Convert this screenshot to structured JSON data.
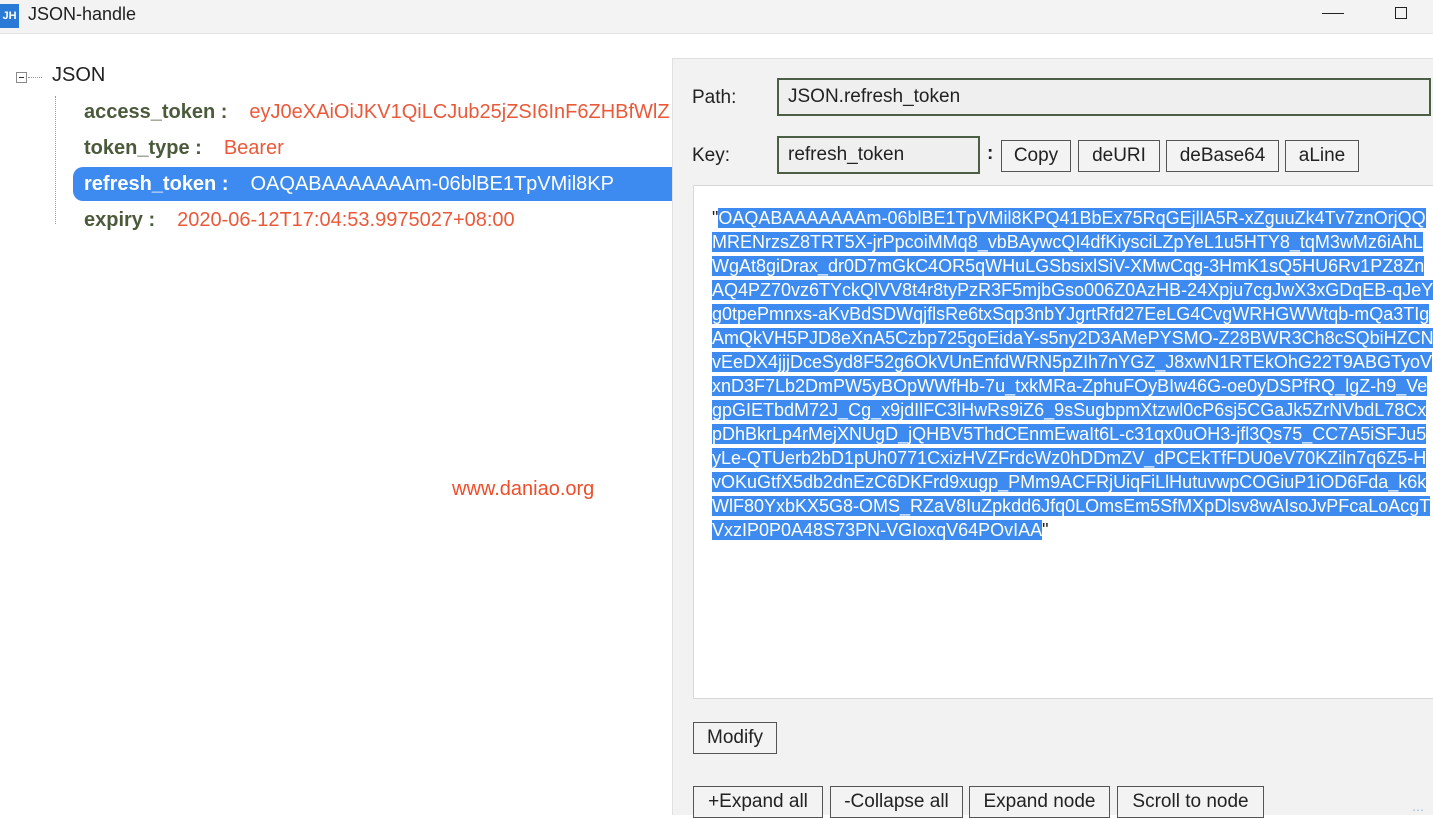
{
  "window": {
    "icon_text": "JH",
    "title": "JSON-handle"
  },
  "tree": {
    "root": "JSON",
    "nodes": [
      {
        "key": "access_token :",
        "value": "eyJ0eXAiOiJKV1QiLCJub25jZSI6InF6ZHBfWlZ",
        "selected": false
      },
      {
        "key": "token_type :",
        "value": "Bearer",
        "selected": false
      },
      {
        "key": "refresh_token :",
        "value": "OAQABAAAAAAAm-06blBE1TpVMil8KP",
        "selected": true
      },
      {
        "key": "expiry :",
        "value": "2020-06-12T17:04:53.9975027+08:00",
        "selected": false
      }
    ]
  },
  "watermark": "www.daniao.org",
  "panel": {
    "path_label": "Path:",
    "path_value": "JSON.refresh_token",
    "key_label": "Key:",
    "key_value": "refresh_token",
    "key_sep": ":",
    "buttons": {
      "copy": "Copy",
      "deuri": "deURI",
      "debase64": "deBase64",
      "aline": "aLine",
      "modify": "Modify",
      "expand_all": "+Expand all",
      "collapse_all": "-Collapse all",
      "expand_node": "Expand node",
      "scroll_to_node": "Scroll to node"
    },
    "value_open_quote": "\"",
    "value_close_quote": "\"",
    "value_text": "OAQABAAAAAAAm-06blBE1TpVMil8KPQ41BbEx75RqGEjllA5R-xZguuZk4Tv7znOrjQQMRENrzsZ8TRT5X-jrPpcoiMMq8_vbBAywcQI4dfKiysciLZpYeL1u5HTY8_tqM3wMz6iAhLWgAt8giDrax_dr0D7mGkC4OR5qWHuLGSbsixlSiV-XMwCqg-3HmK1sQ5HU6Rv1PZ8ZnAQ4PZ70vz6TYckQlVV8t4r8tyPzR3F5mjbGso006Z0AzHB-24Xpju7cgJwX3xGDqEB-qJeYg0tpePmnxs-aKvBdSDWqjflsRe6txSqp3nbYJgrtRfd27EeLG4CvgWRHGWWtqb-mQa3TIgAmQkVH5PJD8eXnA5Czbp725goEidaY-s5ny2D3AMePYSMO-Z28BWR3Ch8cSQbiHZCNvEeDX4jjjDceSyd8F52g6OkVUnEnfdWRN5pZIh7nYGZ_J8xwN1RTEkOhG22T9ABGTyoVxnD3F7Lb2DmPW5yBOpWWfHb-7u_txkMRa-ZphuFOyBIw46G-oe0yDSPfRQ_lgZ-h9_VegpGIETbdM72J_Cg_x9jdIlFC3lHwRs9iZ6_9sSugbpmXtzwl0cP6sj5CGaJk5ZrNVbdL78CxpDhBkrLp4rMejXNUgD_jQHBV5ThdCEnmEwaIt6L-c31qx0uOH3-jfl3Qs75_CC7A5iSFJu5yLe-QTUerb2bD1pUh0771CxizHVZFrdcWz0hDDmZV_dPCEkTfFDU0eV70KZiln7q6Z5-HvOKuGtfX5db2dnEzC6DKFrd9xugp_PMm9ACFRjUiqFiLlHutuvwpCOGiuP1iOD6Fda_k6kWlF80YxbKX5G8-OMS_RZaV8IuZpkdd6Jfq0LOmsEm5SfMXpDlsv8wAIsoJvPFcaLoAcgTVxzIP0P0A48S73PN-VGIoxqV64POvIAA"
  }
}
